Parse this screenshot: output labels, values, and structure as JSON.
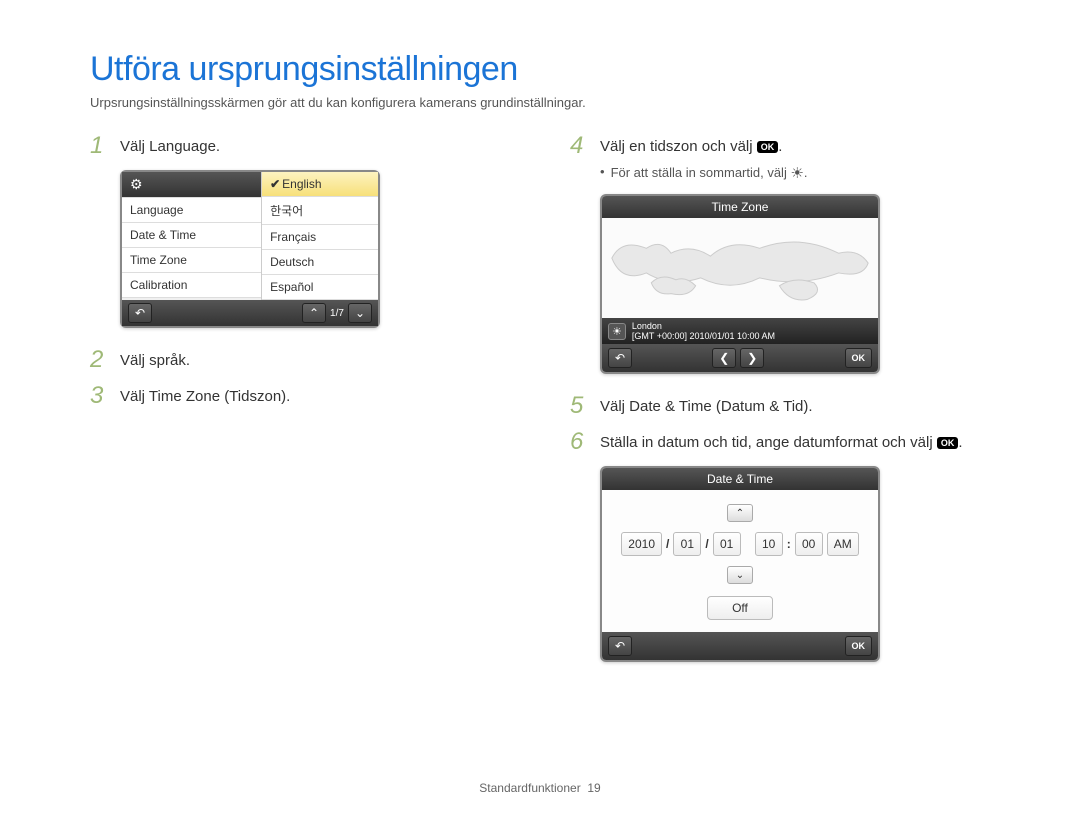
{
  "title": "Utföra ursprungsinställningen",
  "subtitle": "Urpsrungsinställningsskärmen gör att du kan konfigurera kamerans grundinställningar.",
  "left": {
    "step1_num": "1",
    "step1_text": "Välj Language.",
    "step2_num": "2",
    "step2_text": "Välj språk.",
    "step3_num": "3",
    "step3_text": "Välj Time Zone (Tidszon).",
    "device1": {
      "gear_label": "⚙",
      "menu": [
        "Language",
        "Date & Time",
        "Time Zone",
        "Calibration"
      ],
      "langs": [
        {
          "name": "English",
          "selected": true
        },
        {
          "name": "한국어",
          "selected": false
        },
        {
          "name": "Français",
          "selected": false
        },
        {
          "name": "Deutsch",
          "selected": false
        },
        {
          "name": "Español",
          "selected": false
        }
      ],
      "back": "↶",
      "page": "1/7",
      "up": "⌃",
      "down": "⌄"
    }
  },
  "right": {
    "step4_num": "4",
    "step4_text_a": "Välj en tidszon och välj ",
    "step4_text_b": ".",
    "bullet_text_a": "För att ställa in sommartid, välj ",
    "bullet_text_b": ".",
    "sun_glyph": "☀",
    "ok_label": "OK",
    "tz": {
      "title": "Time Zone",
      "city": "London",
      "gmt": "[GMT +00:00] 2010/01/01 10:00 AM",
      "back": "↶",
      "left": "❮",
      "rightb": "❯",
      "ok": "OK"
    },
    "step5_num": "5",
    "step5_text": "Välj Date & Time (Datum & Tid).",
    "step6_num": "6",
    "step6_text_a": "Ställa in datum och tid, ange datumformat och välj ",
    "step6_text_b": ".",
    "dt": {
      "title": "Date & Time",
      "y": "2010",
      "m": "01",
      "d": "01",
      "hh": "10",
      "mm": "00",
      "ampm": "AM",
      "off": "Off",
      "up": "⌃",
      "down": "⌄",
      "back": "↶",
      "ok": "OK"
    }
  },
  "footer_label": "Standardfunktioner",
  "footer_page": "19"
}
